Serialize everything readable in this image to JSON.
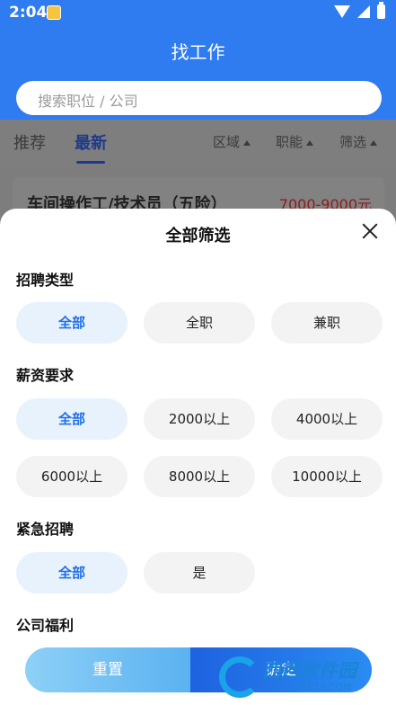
{
  "status_bar": {
    "time": "2:04"
  },
  "header": {
    "title": "找工作"
  },
  "search": {
    "placeholder": "搜索职位 / 公司"
  },
  "tabs": [
    {
      "label": "推荐",
      "active": false
    },
    {
      "label": "最新",
      "active": true
    }
  ],
  "filters": [
    "区域",
    "职能",
    "筛选"
  ],
  "job": {
    "title": "车间操作工/技术员（五险）",
    "salary": "7000-9000元"
  },
  "sheet": {
    "title": "全部筛选",
    "sections": [
      {
        "label": "招聘类型",
        "options": [
          "全部",
          "全职",
          "兼职"
        ],
        "selected": "全部"
      },
      {
        "label": "薪资要求",
        "options": [
          "全部",
          "2000以上",
          "4000以上",
          "6000以上",
          "8000以上",
          "10000以上"
        ],
        "selected": "全部"
      },
      {
        "label": "紧急招聘",
        "options": [
          "全部",
          "是"
        ],
        "selected": "全部"
      },
      {
        "label": "公司福利",
        "options": []
      }
    ],
    "buttons": {
      "reset": "重置",
      "confirm": "确定"
    }
  },
  "watermark": {
    "text": "西西软件园",
    "url": "CR173.COM"
  },
  "colors": {
    "primary": "#2f7bf0",
    "selected_chip_bg": "#e8f2fd",
    "selected_chip_text": "#1f6fe5",
    "salary": "#d33"
  },
  "icons": {
    "close": "close-icon",
    "filter_arrow": "triangle-up-icon"
  }
}
